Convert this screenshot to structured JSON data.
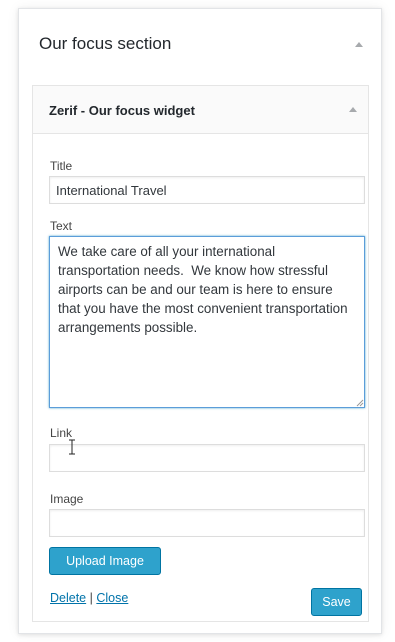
{
  "section": {
    "title": "Our focus section",
    "collapse_icon": "arrow-up-icon"
  },
  "widget": {
    "title": "Zerif - Our focus widget",
    "collapse_icon": "arrow-up-icon",
    "fields": {
      "title_label": "Title",
      "title_value": "International Travel",
      "text_label": "Text",
      "text_value": "We take care of all your international transportation needs.  We know how stressful airports can be and our team is here to ensure that you have the most convenient transportation arrangements possible.",
      "link_label": "Link",
      "link_value": "",
      "image_label": "Image",
      "image_value": ""
    },
    "upload_label": "Upload Image",
    "delete_label": "Delete",
    "separator": "|",
    "close_label": "Close",
    "save_label": "Save"
  },
  "colors": {
    "button_blue": "#2ea2cc",
    "link_blue": "#0073aa",
    "focus_border": "#5b9dd9"
  }
}
